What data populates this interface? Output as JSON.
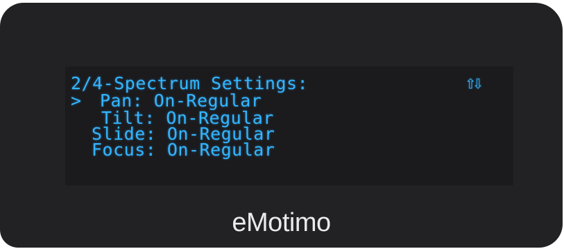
{
  "display": {
    "title": "2/4-Spectrum Settings:",
    "scroll_indicator": "⇧⇩",
    "cursor": ">",
    "settings": [
      {
        "label": "Pan:",
        "value": "On-Regular",
        "selected": true
      },
      {
        "label": "Tilt:",
        "value": "On-Regular",
        "selected": false
      },
      {
        "label": "Slide:",
        "value": "On-Regular",
        "selected": false
      },
      {
        "label": "Focus:",
        "value": "On-Regular",
        "selected": false
      }
    ]
  },
  "device": {
    "brand": "eMotimo"
  },
  "colors": {
    "lcd_text": "#33b6ff",
    "screen_background": "#1b1b1d",
    "bezel": "#222224",
    "brand_text": "#ebebeb"
  }
}
